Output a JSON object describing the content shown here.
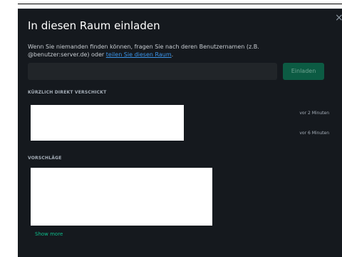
{
  "dialog": {
    "title": "In diesen Raum einladen",
    "close_label": "×",
    "info_text": "Wenn Sie niemanden finden können, fragen Sie nach deren Benutzernamen (z.B. @benutzer:server.de) oder ",
    "info_link": "teilen Sie diesen Raum",
    "info_suffix": ".",
    "input": {
      "value": "",
      "placeholder": ""
    },
    "invite_button": "Einladen"
  },
  "recent": {
    "header": "KÜRZLICH DIREKT VERSCHICKT",
    "times": [
      "vor 2 Minuten",
      "vor 6 Minuten"
    ]
  },
  "suggestions": {
    "header": "VORSCHLÄGE",
    "show_more": "Show more"
  }
}
